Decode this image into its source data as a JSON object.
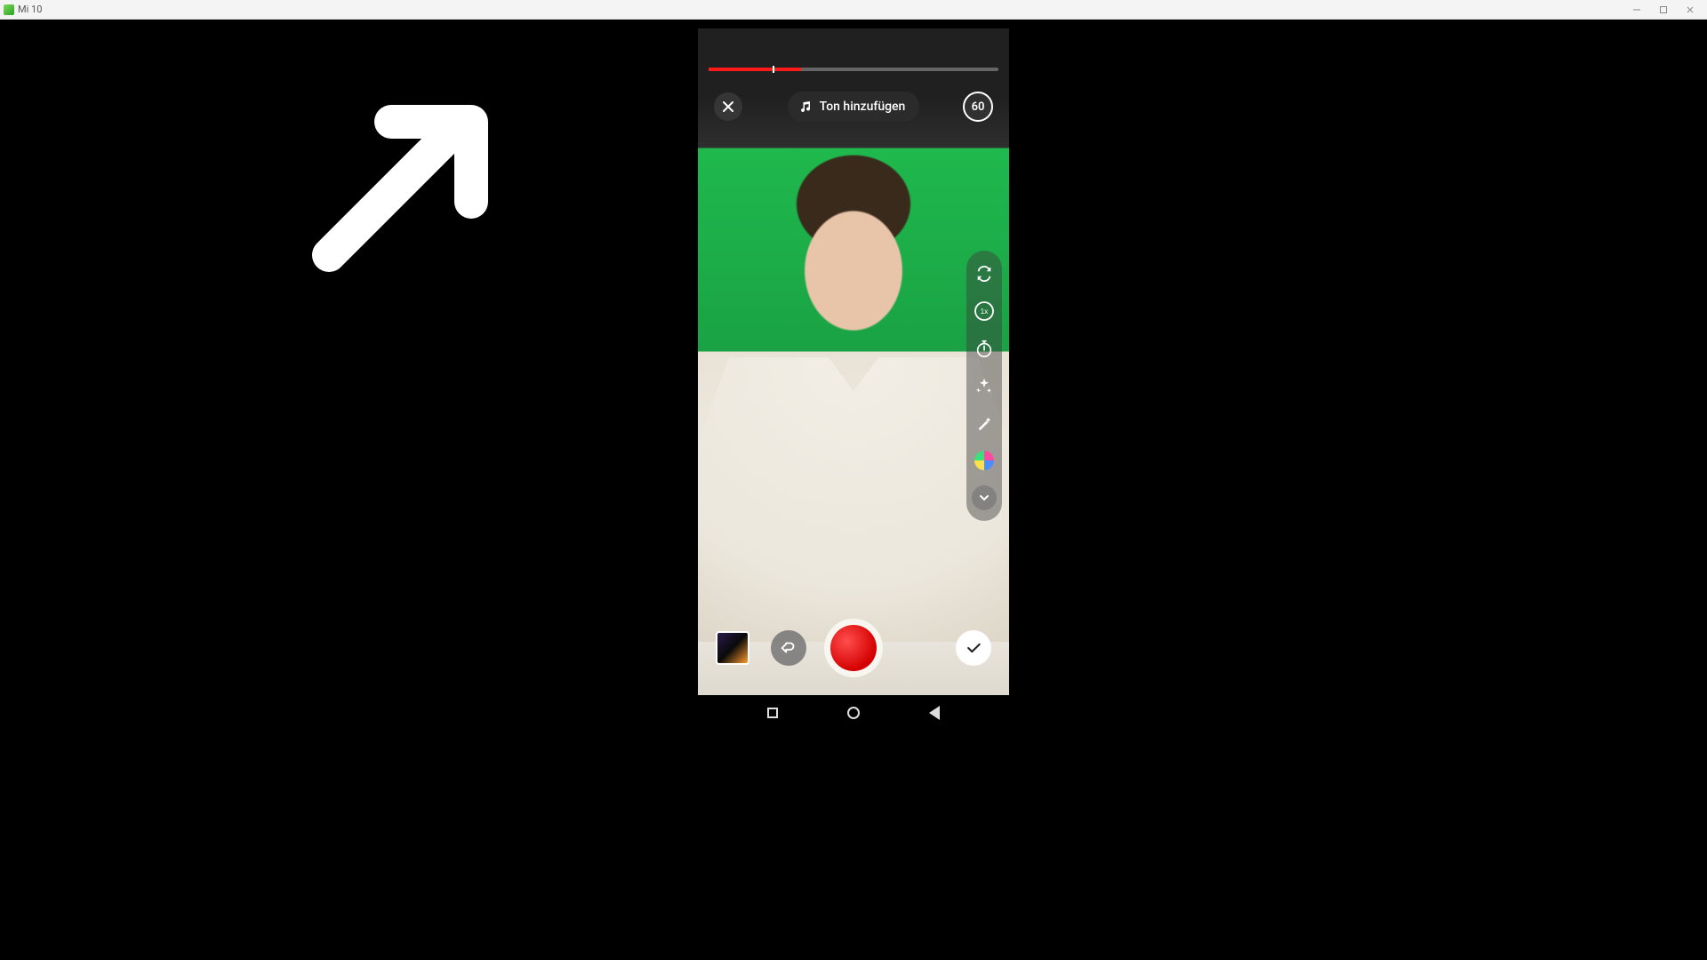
{
  "window": {
    "title": "Mi 10"
  },
  "recorder": {
    "progress": {
      "segments": [
        {
          "start_pct": 0,
          "end_pct": 22
        },
        {
          "start_pct": 23,
          "end_pct": 32
        }
      ],
      "marks_pct": [
        22
      ]
    },
    "close_icon": "close-icon",
    "add_sound_label": "Ton hinzufügen",
    "duration_label": "60",
    "side_tools": [
      {
        "id": "flip-camera",
        "icon": "flip-camera-icon"
      },
      {
        "id": "speed",
        "icon": "speed-1x-icon",
        "label": "1x"
      },
      {
        "id": "countdown",
        "icon": "stopwatch-icon"
      },
      {
        "id": "beautify",
        "icon": "sparkle-icon"
      },
      {
        "id": "retouch",
        "icon": "magic-wand-icon"
      },
      {
        "id": "filters",
        "icon": "color-wheel-icon"
      }
    ],
    "side_expand_icon": "chevron-down-icon",
    "gallery_icon": "gallery-thumbnail",
    "undo_icon": "undo-icon",
    "record_icon": "record-button",
    "confirm_icon": "check-icon"
  },
  "android_nav": {
    "recents_icon": "square-icon",
    "home_icon": "circle-icon",
    "back_icon": "triangle-left-icon"
  },
  "annotation": {
    "arrow_points_to": "progress-bar"
  }
}
